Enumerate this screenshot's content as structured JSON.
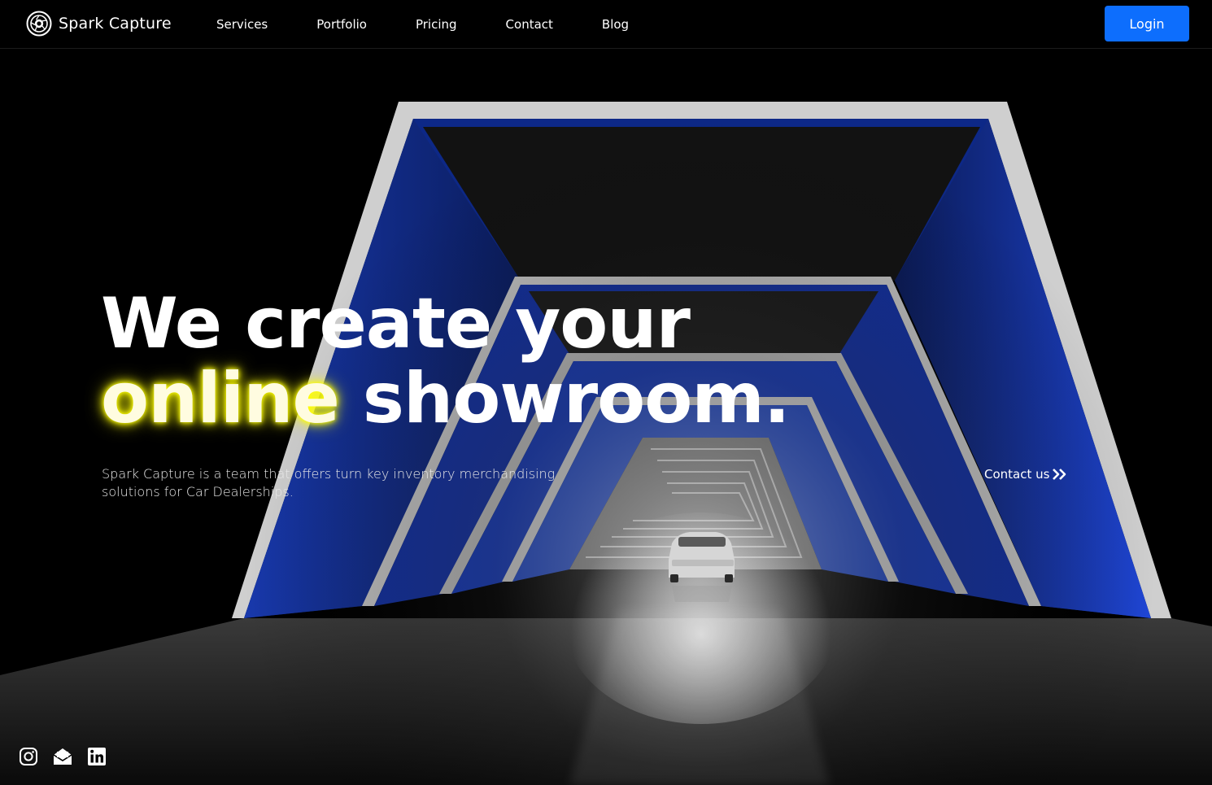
{
  "brand": {
    "name": "Spark Capture",
    "logo_icon": "aperture-logo-icon"
  },
  "nav": {
    "links": [
      {
        "label": "Services"
      },
      {
        "label": "Portfolio"
      },
      {
        "label": "Pricing"
      },
      {
        "label": "Contact"
      },
      {
        "label": "Blog"
      }
    ],
    "login_label": "Login"
  },
  "hero": {
    "title_line1": "We create your",
    "title_highlight": "online",
    "title_rest": "showroom.",
    "description": "Spark Capture is a team that offers turn key inventory merchandising solutions for Car Dealerships.",
    "contact_label": "Contact us",
    "contact_icon": "double-chevron-right-icon"
  },
  "socials": [
    {
      "icon": "instagram-icon"
    },
    {
      "icon": "envelope-open-icon"
    },
    {
      "icon": "linkedin-icon"
    }
  ],
  "colors": {
    "accent_button": "#0d6efd",
    "highlight_glow": "#ffff00",
    "tunnel_blue": "#1a3cb4",
    "background": "#000000"
  }
}
